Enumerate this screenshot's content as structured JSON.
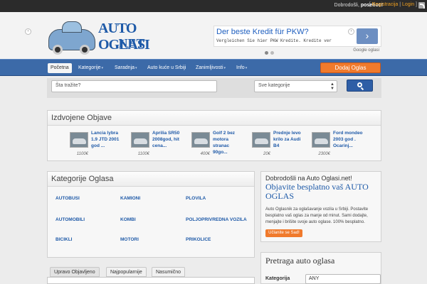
{
  "topbar": {
    "greeting_prefix": "Dobrodošli, ",
    "greeting_user": "posetioc!",
    "register": "Registracija",
    "login": "Login",
    "sep1": "[ ",
    "sep2": " | ",
    "sep3": " ]"
  },
  "logo": {
    "line1": "AUTO OGLASI",
    "line2": ".NET"
  },
  "ad": {
    "headline": "Der beste Kredit für PKW?",
    "sub": "Vergleichen Sie hier PKW Kredite. Kredite ver",
    "arrow": "›",
    "brand": "Google oglasi"
  },
  "nav": {
    "items": [
      {
        "label": "Početna",
        "caret": ""
      },
      {
        "label": "Kategorije",
        "caret": "▾"
      },
      {
        "label": "Saradnja",
        "caret": "▾"
      },
      {
        "label": "Auto kuće u Srbiji",
        "caret": ""
      },
      {
        "label": "Zanimljivosti",
        "caret": "▾"
      },
      {
        "label": "Info",
        "caret": "▾"
      }
    ],
    "add_label": "Dodaj Oglas"
  },
  "search": {
    "placeholder": "Šta tražite?",
    "category": "Sve kategorije"
  },
  "featured": {
    "title": "Izdvojene Objave",
    "items": [
      {
        "title": "Lancia lybra 1.9 JTD 2001 god ...",
        "price": "1100€"
      },
      {
        "title": "Aprilia SR50 2008god, hit cena...",
        "price": "1100€"
      },
      {
        "title": "Golf 2 bez motora stranac 90go...",
        "price": "400€"
      },
      {
        "title": "Prednje levo krilo za Audi B4",
        "price": "20€"
      },
      {
        "title": "Ford mondeo 2003 god . Ocarinj...",
        "price": "2300€"
      }
    ]
  },
  "categories": {
    "title": "Kategorije Oglasa",
    "items": [
      "AUTOBUSI",
      "KAMIONI",
      "PLOVILA",
      "AUTOMOBILI",
      "KOMBI",
      "POLJOPRIVREDNA VOZILA",
      "BICIKLI",
      "MOTORI",
      "PRIKOLICE"
    ]
  },
  "welcome": {
    "title": "Dobrodošli na Auto Oglasi.net!",
    "headline": "Objavite besplatno vaš AUTO OGLAS",
    "text": "Auto Oglasnik za oglašavanje vozila u Srbiji. Postavite besplatno vaš oglas za manje od minut. Sami dodajte, menjajte i brišite svoje auto oglase. 100% besplatno.",
    "button": "Učlanite se Sad!"
  },
  "tabs": [
    "Upravo Objavljeno",
    "Najpopularnije",
    "Nasumično"
  ],
  "pretraga": {
    "title": "Pretraga auto oglasa",
    "label": "Kategorija",
    "value": "ANY"
  },
  "colors": {
    "nav": "#3c6aa8",
    "accent": "#f07a2c",
    "link": "#1f5aa8"
  }
}
